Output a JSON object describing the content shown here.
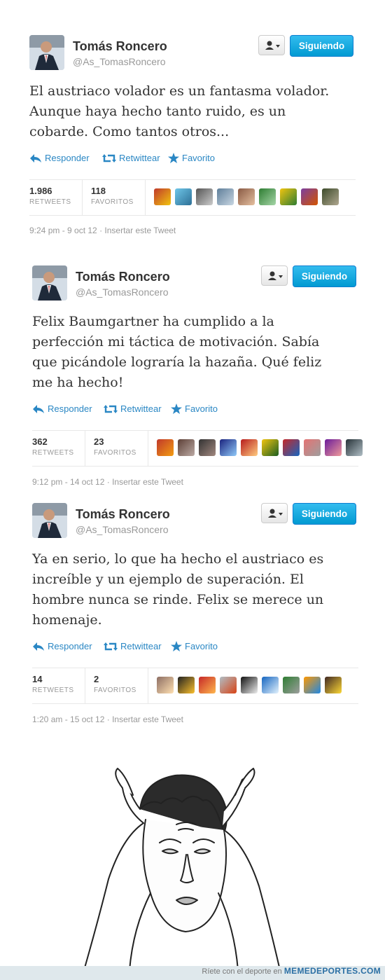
{
  "tweets": [
    {
      "name": "Tomás Roncero",
      "handle": "@As_TomasRoncero",
      "follow_label": "Siguiendo",
      "text": "El austriaco volador es un fantasma volador.\nAunque haya hecho tanto ruido, es un\ncobarde. Como tantos otros...",
      "reply_label": "Responder",
      "retweet_label": "Retwittear",
      "favorite_label": "Favorito",
      "retweets_count": "1.986",
      "retweets_label": "RETWEETS",
      "favorites_count": "118",
      "favorites_label": "FAVORITOS",
      "timestamp": "9:24 pm - 9 oct 12",
      "embed_label": "Insertar este Tweet"
    },
    {
      "name": "Tomás Roncero",
      "handle": "@As_TomasRoncero",
      "follow_label": "Siguiendo",
      "text": "Felix Baumgartner ha cumplido a la\nperfección mi táctica de motivación. Sabía\nque picándole lograría la hazaña. Qué feliz\nme ha hecho!",
      "reply_label": "Responder",
      "retweet_label": "Retwittear",
      "favorite_label": "Favorito",
      "retweets_count": "362",
      "retweets_label": "RETWEETS",
      "favorites_count": "23",
      "favorites_label": "FAVORITOS",
      "timestamp": "9:12 pm - 14 oct 12",
      "embed_label": "Insertar este Tweet"
    },
    {
      "name": "Tomás Roncero",
      "handle": "@As_TomasRoncero",
      "follow_label": "Siguiendo",
      "text": "Ya en serio, lo que ha hecho el austriaco es\nincreíble y un ejemplo de superación. El\nhombre nunca se rinde. Felix se merece un\nhomenaje.",
      "reply_label": "Responder",
      "retweet_label": "Retwittear",
      "favorite_label": "Favorito",
      "retweets_count": "14",
      "retweets_label": "RETWEETS",
      "favorites_count": "2",
      "favorites_label": "FAVORITOS",
      "timestamp": "1:20 am - 15 oct 12",
      "embed_label": "Insertar este Tweet"
    }
  ],
  "footer": {
    "tagline": "Ríete con el deporte en",
    "site": "MEMEDEPORTES.COM"
  },
  "colors": {
    "link": "#2a87c4",
    "follow_button": "#0f9ed8"
  },
  "icons": [
    "reply-icon",
    "retweet-icon",
    "star-icon",
    "user-icon",
    "caret-down-icon"
  ]
}
